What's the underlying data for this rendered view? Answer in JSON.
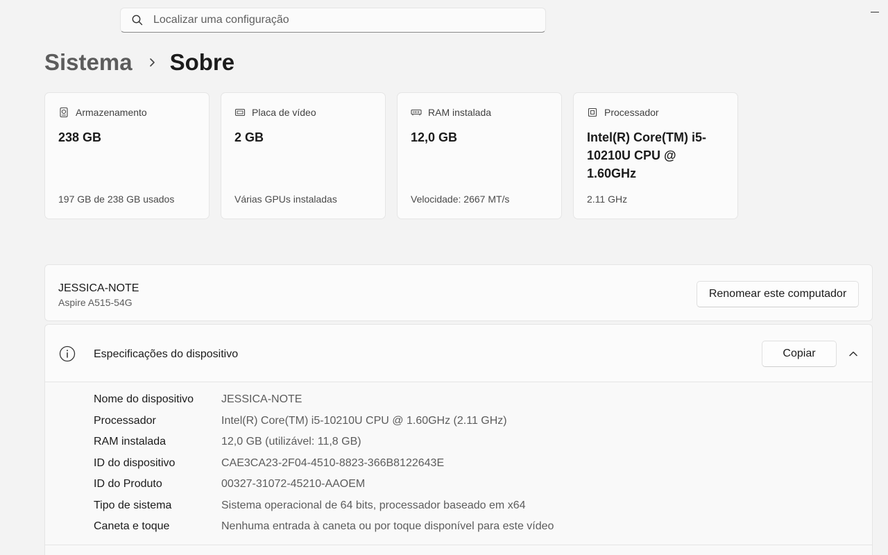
{
  "search": {
    "placeholder": "Localizar uma configuração",
    "icon": "search-icon"
  },
  "breadcrumb": {
    "parent": "Sistema",
    "current": "Sobre"
  },
  "cards": [
    {
      "icon": "storage-icon",
      "label": "Armazenamento",
      "value": "238 GB",
      "footer": "197 GB de 238 GB usados"
    },
    {
      "icon": "gpu-icon",
      "label": "Placa de vídeo",
      "value": "2 GB",
      "footer": "Várias GPUs instaladas"
    },
    {
      "icon": "ram-icon",
      "label": "RAM instalada",
      "value": "12,0 GB",
      "footer": "Velocidade: 2667 MT/s"
    },
    {
      "icon": "processor-icon",
      "label": "Processador",
      "value": "Intel(R) Core(TM) i5-10210U CPU @ 1.60GHz",
      "footer": "2.11 GHz"
    }
  ],
  "computer": {
    "name": "JESSICA-NOTE",
    "model": "Aspire A515-54G",
    "rename_label": "Renomear este computador"
  },
  "specs": {
    "title": "Especificações do dispositivo",
    "copy_label": "Copiar",
    "rows": [
      {
        "label": "Nome do dispositivo",
        "value": "JESSICA-NOTE"
      },
      {
        "label": "Processador",
        "value": "Intel(R) Core(TM) i5-10210U CPU @ 1.60GHz (2.11 GHz)"
      },
      {
        "label": "RAM instalada",
        "value": "12,0 GB (utilizável: 11,8 GB)"
      },
      {
        "label": "ID do dispositivo",
        "value": "CAE3CA23-2F04-4510-8823-366B8122643E"
      },
      {
        "label": "ID do Produto",
        "value": "00327-31072-45210-AAOEM"
      },
      {
        "label": "Tipo de sistema",
        "value": "Sistema operacional de 64 bits, processador baseado em x64"
      },
      {
        "label": "Caneta e toque",
        "value": "Nenhuma entrada à caneta ou por toque disponível para este vídeo"
      }
    ]
  }
}
